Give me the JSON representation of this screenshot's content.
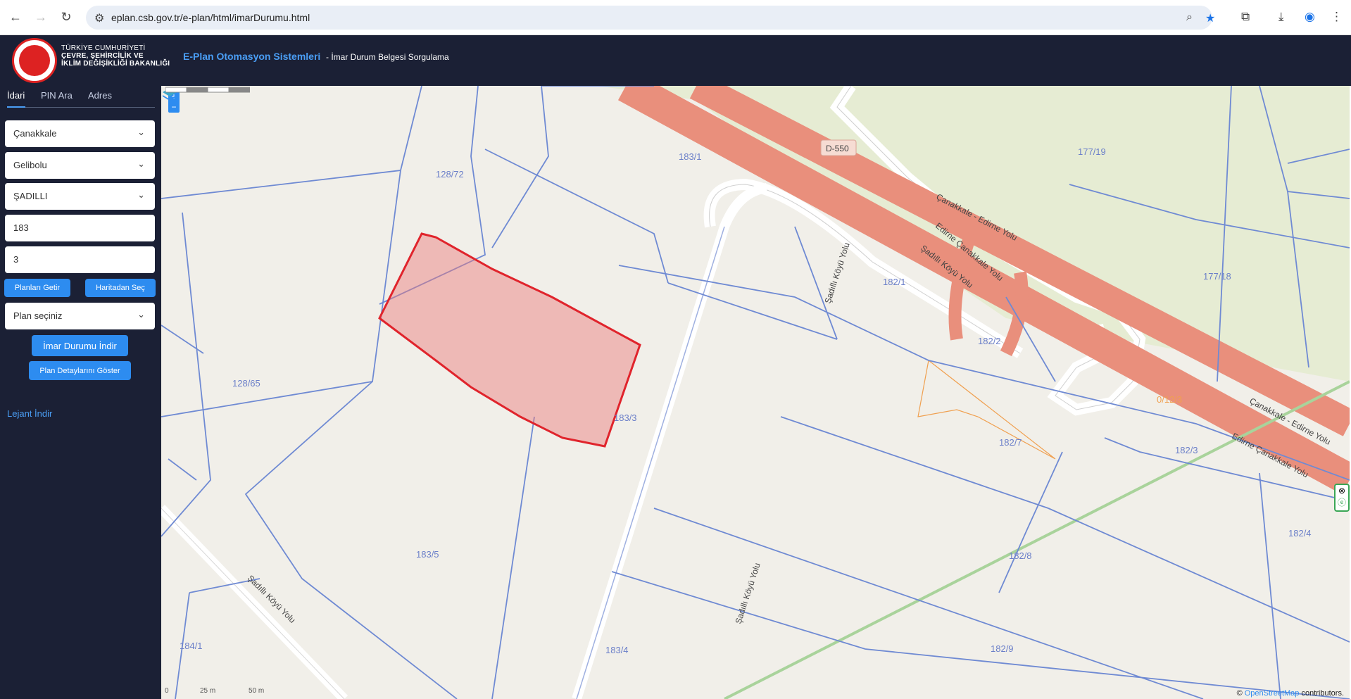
{
  "browser": {
    "url": "eplan.csb.gov.tr/e-plan/html/imarDurumu.html"
  },
  "header": {
    "ministry_line1": "TÜRKİYE CUMHURİYETİ",
    "ministry_line2": "ÇEVRE, ŞEHİRCİLİK VE",
    "ministry_line3": "İKLİM DEĞİŞİKLİĞİ BAKANLIĞI",
    "app_title": "E-Plan Otomasyon Sistemleri",
    "app_subtitle": "- İmar Durum Belgesi Sorgulama"
  },
  "sidebar": {
    "tabs": [
      "İdari",
      "PIN Ara",
      "Adres"
    ],
    "active_tab": "İdari",
    "province": "Çanakkale",
    "district": "Gelibolu",
    "neighborhood": "ŞADILLI",
    "block": "183",
    "parcel": "3",
    "btn_plans": "Planları Getir",
    "btn_map_select": "Haritadan Seç",
    "plan_select": "Plan seçiniz",
    "btn_download": "İmar Durumu İndir",
    "btn_plan_details": "Plan Detaylarını Göster",
    "legend_link": "Lejant İndir"
  },
  "map": {
    "zoom_in": "+",
    "zoom_out": "−",
    "parcel_labels": [
      "128/72",
      "183/1",
      "177/19",
      "177/18",
      "182/1",
      "182/2",
      "128/65",
      "183/3",
      "182/7",
      "182/3",
      "0/12/3",
      "183/5",
      "182/8",
      "182/4",
      "184/1",
      "183/4",
      "182/9"
    ],
    "road_labels": [
      "D-550",
      "Çanakkale - Edirne Yolu",
      "Edirne Çanakkale Yolu",
      "Şadıllı Köyü Yolu",
      "Şadıllı Köyü Yolu",
      "Şadıllı Köyü Yolu",
      "Şadıllı Köyü Yolu",
      "Çanakkale - Edirne Yolu",
      "Edirne Çanakkale Yolu"
    ],
    "scale_0": "0",
    "scale_25": "25 m",
    "scale_50": "50 m",
    "attribution_prefix": "©",
    "attribution_link": "OpenStreetMap",
    "attribution_suffix": "contributors.",
    "highlight_color": "#e0242c",
    "parcel_line_color": "#6f8ad3"
  }
}
